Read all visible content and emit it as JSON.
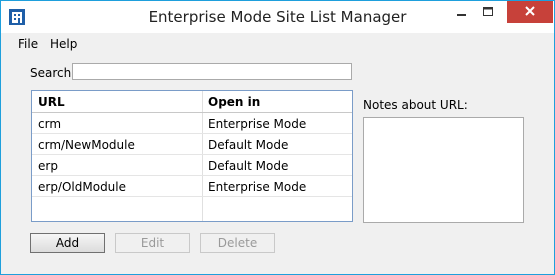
{
  "window": {
    "title": "Enterprise Mode Site List Manager"
  },
  "icons": {
    "app": "app-icon",
    "minimize": "minimize-icon",
    "maximize": "maximize-icon",
    "close": "close-icon"
  },
  "colors": {
    "border": "#1e9fdc",
    "close_button": "#c7413a"
  },
  "menu": {
    "items": [
      {
        "label": "File"
      },
      {
        "label": "Help"
      }
    ]
  },
  "search": {
    "label": "Search:",
    "value": ""
  },
  "table": {
    "headers": {
      "url": "URL",
      "open_in": "Open in"
    },
    "rows": [
      {
        "url": "crm",
        "open_in": "Enterprise Mode"
      },
      {
        "url": "crm/NewModule",
        "open_in": "Default Mode"
      },
      {
        "url": "erp",
        "open_in": "Default Mode"
      },
      {
        "url": "erp/OldModule",
        "open_in": "Enterprise Mode"
      }
    ]
  },
  "notes": {
    "label": "Notes about URL:",
    "value": ""
  },
  "buttons": {
    "add": "Add",
    "edit": "Edit",
    "delete": "Delete"
  }
}
